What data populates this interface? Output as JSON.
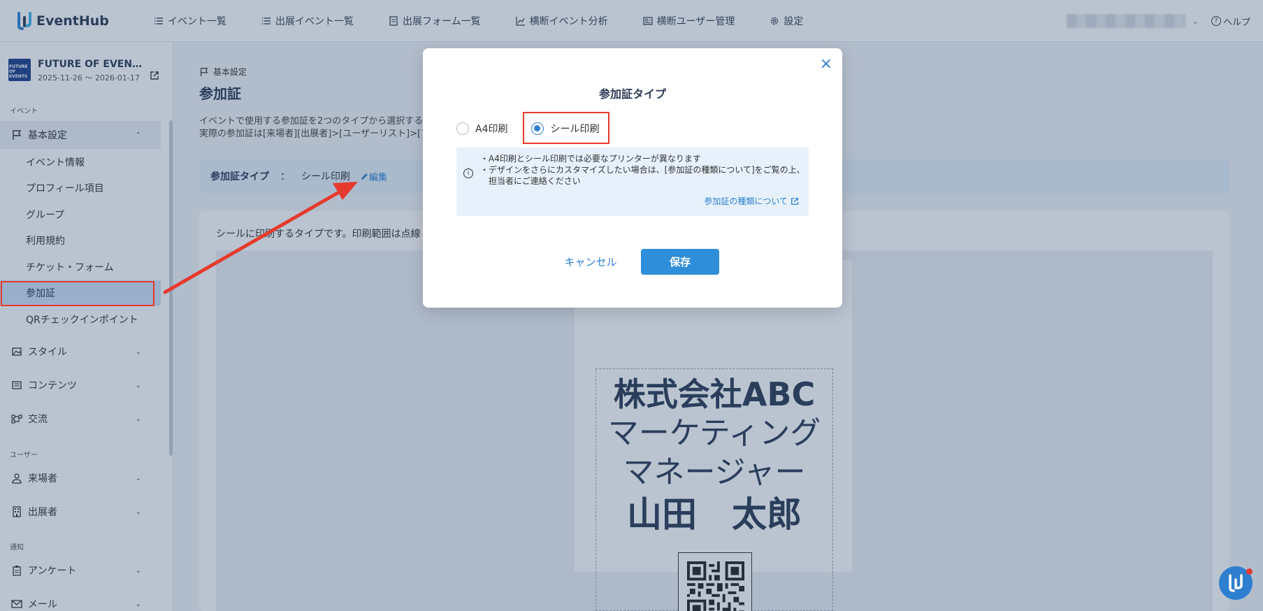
{
  "app": {
    "name": "EventHub"
  },
  "nav": {
    "items": [
      {
        "label": "イベント一覧",
        "icon": "list-icon"
      },
      {
        "label": "出展イベント一覧",
        "icon": "list-icon"
      },
      {
        "label": "出展フォーム一覧",
        "icon": "form-icon"
      },
      {
        "label": "横断イベント分析",
        "icon": "chart-icon"
      },
      {
        "label": "横断ユーザー管理",
        "icon": "id-card-icon"
      },
      {
        "label": "設定",
        "icon": "gear-icon"
      }
    ],
    "help": "ヘルプ"
  },
  "event": {
    "name": "FUTURE OF EVENTS",
    "dates": "2025-11-26 ～ 2026-01-17",
    "thumb_text": "FUTURE OF EVENTS"
  },
  "sidebar": {
    "section_event": "イベント",
    "basic_settings": "基本設定",
    "sub_items": [
      "イベント情報",
      "プロフィール項目",
      "グループ",
      "利用規約",
      "チケット・フォーム",
      "参加証",
      "QRチェックインポイント"
    ],
    "groups": [
      "スタイル",
      "コンテンツ",
      "交流"
    ],
    "section_user": "ユーザー",
    "user_groups": [
      "来場者",
      "出展者"
    ],
    "section_notify": "通知",
    "notify_groups": [
      "アンケート",
      "メール"
    ]
  },
  "main": {
    "breadcrumb": "基本設定",
    "title": "参加証",
    "desc_line1": "イベントで使用する参加証を2つのタイプから選択する",
    "desc_line2": "実際の参加証は[来場者][出展者]>[ユーザーリスト]>[プ",
    "type_label": "参加証タイプ",
    "type_colon": "：",
    "type_value": "シール印刷",
    "edit_label": "編集",
    "panel_text": "シールに印刷するタイプです。印刷範囲は点線",
    "badge": {
      "company": "株式会社ABC",
      "role_line1": "マーケティング",
      "role_line2": "マネージャー",
      "name": "山田　太郎"
    }
  },
  "modal": {
    "title": "参加証タイプ",
    "options": [
      "A4印刷",
      "シール印刷"
    ],
    "selected": "シール印刷",
    "info_line1": "・A4印刷とシール印刷では必要なプリンターが異なります",
    "info_line2": "・デザインをさらにカスタマイズしたい場合は、[参加証の種類について]をご覧の上、",
    "info_line3": "　担当者にご連絡ください",
    "info_link": "参加証の種類について",
    "cancel": "キャンセル",
    "save": "保存",
    "close": "×"
  },
  "colors": {
    "accent": "#2f7fd0",
    "highlight": "#e53a2d",
    "info_bg": "#e6f1fb"
  }
}
